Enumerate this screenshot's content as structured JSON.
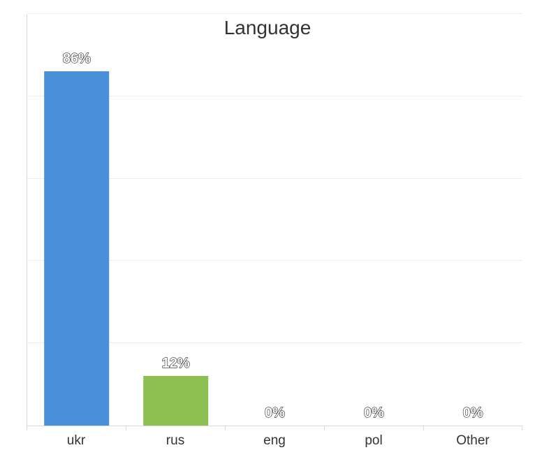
{
  "chart_data": {
    "type": "bar",
    "title": "Language",
    "categories": [
      "ukr",
      "rus",
      "eng",
      "pol",
      "Other"
    ],
    "values": [
      86,
      12,
      0,
      0,
      0
    ],
    "value_labels": [
      "86%",
      "12%",
      "0%",
      "0%",
      "0%"
    ],
    "ylim": [
      0,
      100
    ],
    "gridlines": [
      20,
      40,
      60,
      80,
      100
    ],
    "colors": [
      "#4a90d9",
      "#8cc152",
      "#8cc152",
      "#8cc152",
      "#8cc152"
    ]
  }
}
